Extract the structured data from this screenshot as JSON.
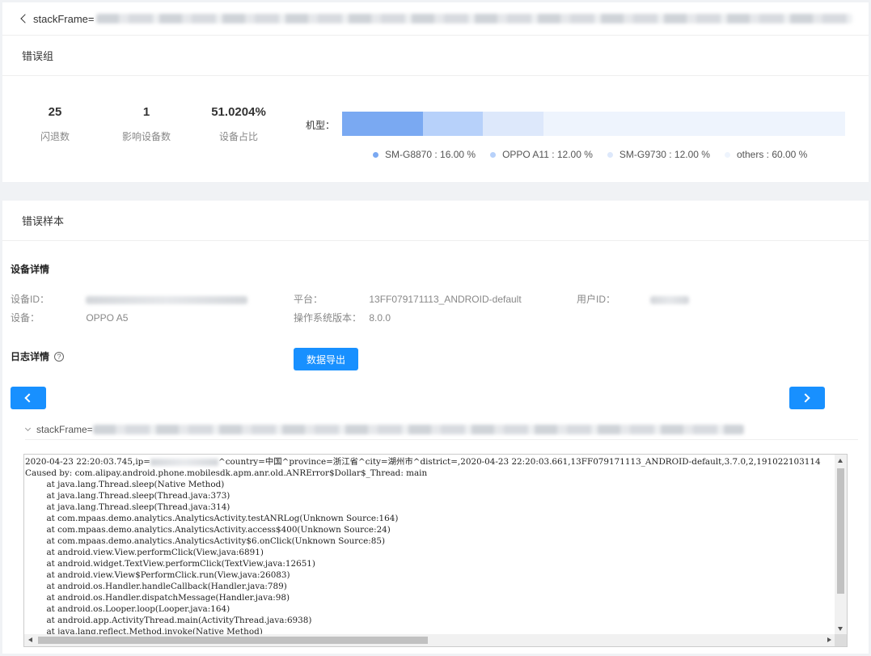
{
  "header": {
    "title_prefix": "stackFrame="
  },
  "error_group": {
    "title": "错误组",
    "stats": [
      {
        "value": "25",
        "label": "闪退数"
      },
      {
        "value": "1",
        "label": "影响设备数"
      },
      {
        "value": "51.0204%",
        "label": "设备占比"
      }
    ],
    "model_label": "机型：",
    "models": [
      {
        "name": "SM-G8870",
        "percent": 16,
        "legend": "SM-G8870 : 16.00 %",
        "color": "#7aa9f2"
      },
      {
        "name": "OPPO A11",
        "percent": 12,
        "legend": "OPPO A11 : 12.00 %",
        "color": "#b7d1fa"
      },
      {
        "name": "SM-G9730",
        "percent": 12,
        "legend": "SM-G9730 : 12.00 %",
        "color": "#dde8fb"
      },
      {
        "name": "others",
        "percent": 60,
        "legend": "others : 60.00 %",
        "color": "#eef4fd"
      }
    ]
  },
  "sample": {
    "title": "错误样本",
    "device_title": "设备详情",
    "device_id_label": "设备ID：",
    "device_label": "设备：",
    "device_value": "OPPO A5",
    "platform_label": "平台：",
    "platform_value": "13FF079171113_ANDROID-default",
    "os_label": "操作系统版本：",
    "os_value": "8.0.0",
    "user_id_label": "用户ID：",
    "log_title": "日志详情",
    "help_glyph": "?",
    "export_label": "数据导出",
    "frame_prefix": "stackFrame=",
    "log_line1_a": "2020-04-23 22:20:03.745,ip=",
    "log_line1_b": "^country=中国^province=浙江省^city=湖州市^district=,2020-04-23 22:20:03.661,13FF079171113_ANDROID-default,3.7.0,2,191022103114",
    "log_lines": [
      "Caused by: com.alipay.android.phone.mobilesdk.apm.anr.old.ANRError$Dollar$_Thread: main",
      "\tat java.lang.Thread.sleep(Native Method)",
      "\tat java.lang.Thread.sleep(Thread.java:373)",
      "\tat java.lang.Thread.sleep(Thread.java:314)",
      "\tat com.mpaas.demo.analytics.AnalyticsActivity.testANRLog(Unknown Source:164)",
      "\tat com.mpaas.demo.analytics.AnalyticsActivity.access$400(Unknown Source:24)",
      "\tat com.mpaas.demo.analytics.AnalyticsActivity$6.onClick(Unknown Source:85)",
      "\tat android.view.View.performClick(View.java:6891)",
      "\tat android.widget.TextView.performClick(TextView.java:12651)",
      "\tat android.view.View$PerformClick.run(View.java:26083)",
      "\tat android.os.Handler.handleCallback(Handler.java:789)",
      "\tat android.os.Handler.dispatchMessage(Handler.java:98)",
      "\tat android.os.Looper.loop(Looper.java:164)",
      "\tat android.app.ActivityThread.main(ActivityThread.java:6938)",
      "\tat java.lang.reflect.Method.invoke(Native Method)"
    ]
  }
}
